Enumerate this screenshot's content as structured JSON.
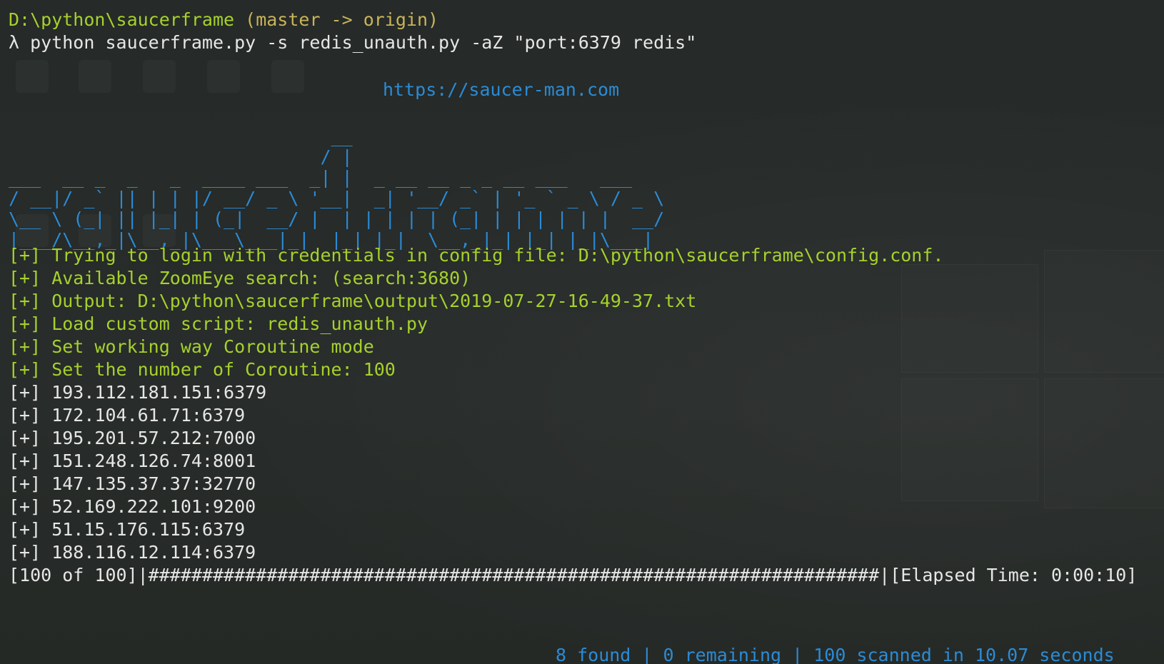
{
  "prompt": {
    "path": "D:\\python\\saucerframe",
    "branch": "(master -> origin)"
  },
  "command": "λ python saucerframe.py -s redis_unauth.py -aZ \"port:6379 redis\"",
  "banner": {
    "url": "https://saucer-man.com",
    "art": "                              __\n                             / |\n___  __ _  _   _  ____ ___  _| |  _ __ __ _ _ __ ___   ___\n/ __|/ _` || | | |/ __/ _ \\ '__|  _| '__/ _` | '_ ` _ \\ / _ \\\n\\__ \\ (_| || |_| | (_|  __/ |  | | | | | (_| | | | | | |  __/\n|___/\\__,_|\\__,_|\\___\\___|_|  |_| |_|  \\__,_|_| |_| |_|\\___|"
  },
  "log": [
    "[+] Trying to login with credentials in config file: D:\\python\\saucerframe\\config.conf.",
    "[+] Available ZoomEye search: (search:3680)",
    "[+] Output: D:\\python\\saucerframe\\output\\2019-07-27-16-49-37.txt",
    "[+] Load custom script: redis_unauth.py",
    "[+] Set working way Coroutine mode",
    "[+] Set the number of Coroutine: 100"
  ],
  "results": [
    "[+] 193.112.181.151:6379",
    "[+] 172.104.61.71:6379",
    "[+] 195.201.57.212:7000",
    "[+] 151.248.126.74:8001",
    "[+] 147.135.37.37:32770",
    "[+] 52.169.222.101:9200",
    "[+] 51.15.176.115:6379",
    "[+] 188.116.12.114:6379"
  ],
  "progress": {
    "text": "[100 of 100]|####################################################################|[Elapsed Time: 0:00:10]",
    "done": 100,
    "total": 100
  },
  "summary": "8 found | 0 remaining | 100 scanned in 10.07 seconds",
  "colors": {
    "background": "#272b29",
    "green": "#a6d12c",
    "white": "#e6e6e6",
    "blue": "#2b8bd6"
  }
}
